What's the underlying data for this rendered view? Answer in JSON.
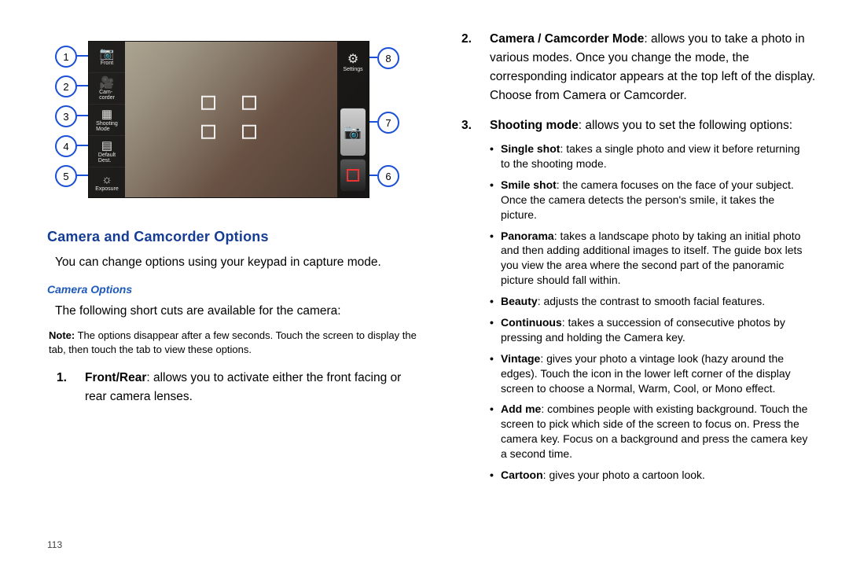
{
  "diagram": {
    "left_icons": [
      {
        "glyph": "📷",
        "label": "Front"
      },
      {
        "glyph": "🎥",
        "label": "Cam-\ncorder"
      },
      {
        "glyph": "▦",
        "label": "Shooting\nMode"
      },
      {
        "glyph": "▤",
        "label": "Default\nDest."
      },
      {
        "glyph": "☼",
        "label": "Exposure"
      }
    ],
    "right_icons": {
      "settings_glyph": "⚙",
      "settings_label": "Settings",
      "shutter_glyph": "📷"
    },
    "callouts_left": [
      "1",
      "2",
      "3",
      "4",
      "5"
    ],
    "callouts_right": [
      "8",
      "7",
      "6"
    ]
  },
  "left": {
    "heading": "Camera and Camcorder Options",
    "intro": "You can change options using your keypad in capture mode.",
    "subheading": "Camera Options",
    "shortcuts_line": "The following short cuts are available for the camera:",
    "note_label": "Note:",
    "note_text": "The options disappear after a few seconds. Touch the screen to display the tab, then touch the tab to view these options.",
    "item1_num": "1.",
    "item1_bold": "Front/Rear",
    "item1_rest": ": allows you to activate either the front facing or rear camera lenses."
  },
  "right": {
    "item2_num": "2.",
    "item2_bold": "Camera / Camcorder Mode",
    "item2_rest": ": allows you to take a photo in various modes. Once you change the mode, the corresponding indicator appears at the top left of the display. Choose from Camera or Camcorder.",
    "item3_num": "3.",
    "item3_bold": "Shooting mode",
    "item3_rest": ": allows you to set the following options:",
    "bullets": [
      {
        "bold": "Single shot",
        "rest": ": takes a single photo and view it before returning to the shooting mode."
      },
      {
        "bold": "Smile shot",
        "rest": ": the camera focuses on the face of your subject. Once the camera detects the person's smile, it takes the picture."
      },
      {
        "bold": "Panorama",
        "rest": ": takes a landscape photo by taking an initial photo and then adding additional images to itself. The guide box lets you view the area where the second part of the panoramic picture should fall within."
      },
      {
        "bold": "Beauty",
        "rest": ": adjusts the contrast to smooth facial features."
      },
      {
        "bold": "Continuous",
        "rest": ": takes a succession of consecutive photos by pressing and holding the Camera key."
      },
      {
        "bold": "Vintage",
        "rest": ": gives your photo a vintage look (hazy around the edges). Touch the icon in the lower left corner of the display screen to choose a Normal, Warm, Cool, or Mono effect."
      },
      {
        "bold": "Add me",
        "rest": ": combines people with existing background. Touch the screen to pick which side of the screen to focus on. Press the camera key. Focus on a background and press the camera key a second time."
      },
      {
        "bold": "Cartoon",
        "rest": ": gives your photo a cartoon look."
      }
    ]
  },
  "page_number": "113"
}
